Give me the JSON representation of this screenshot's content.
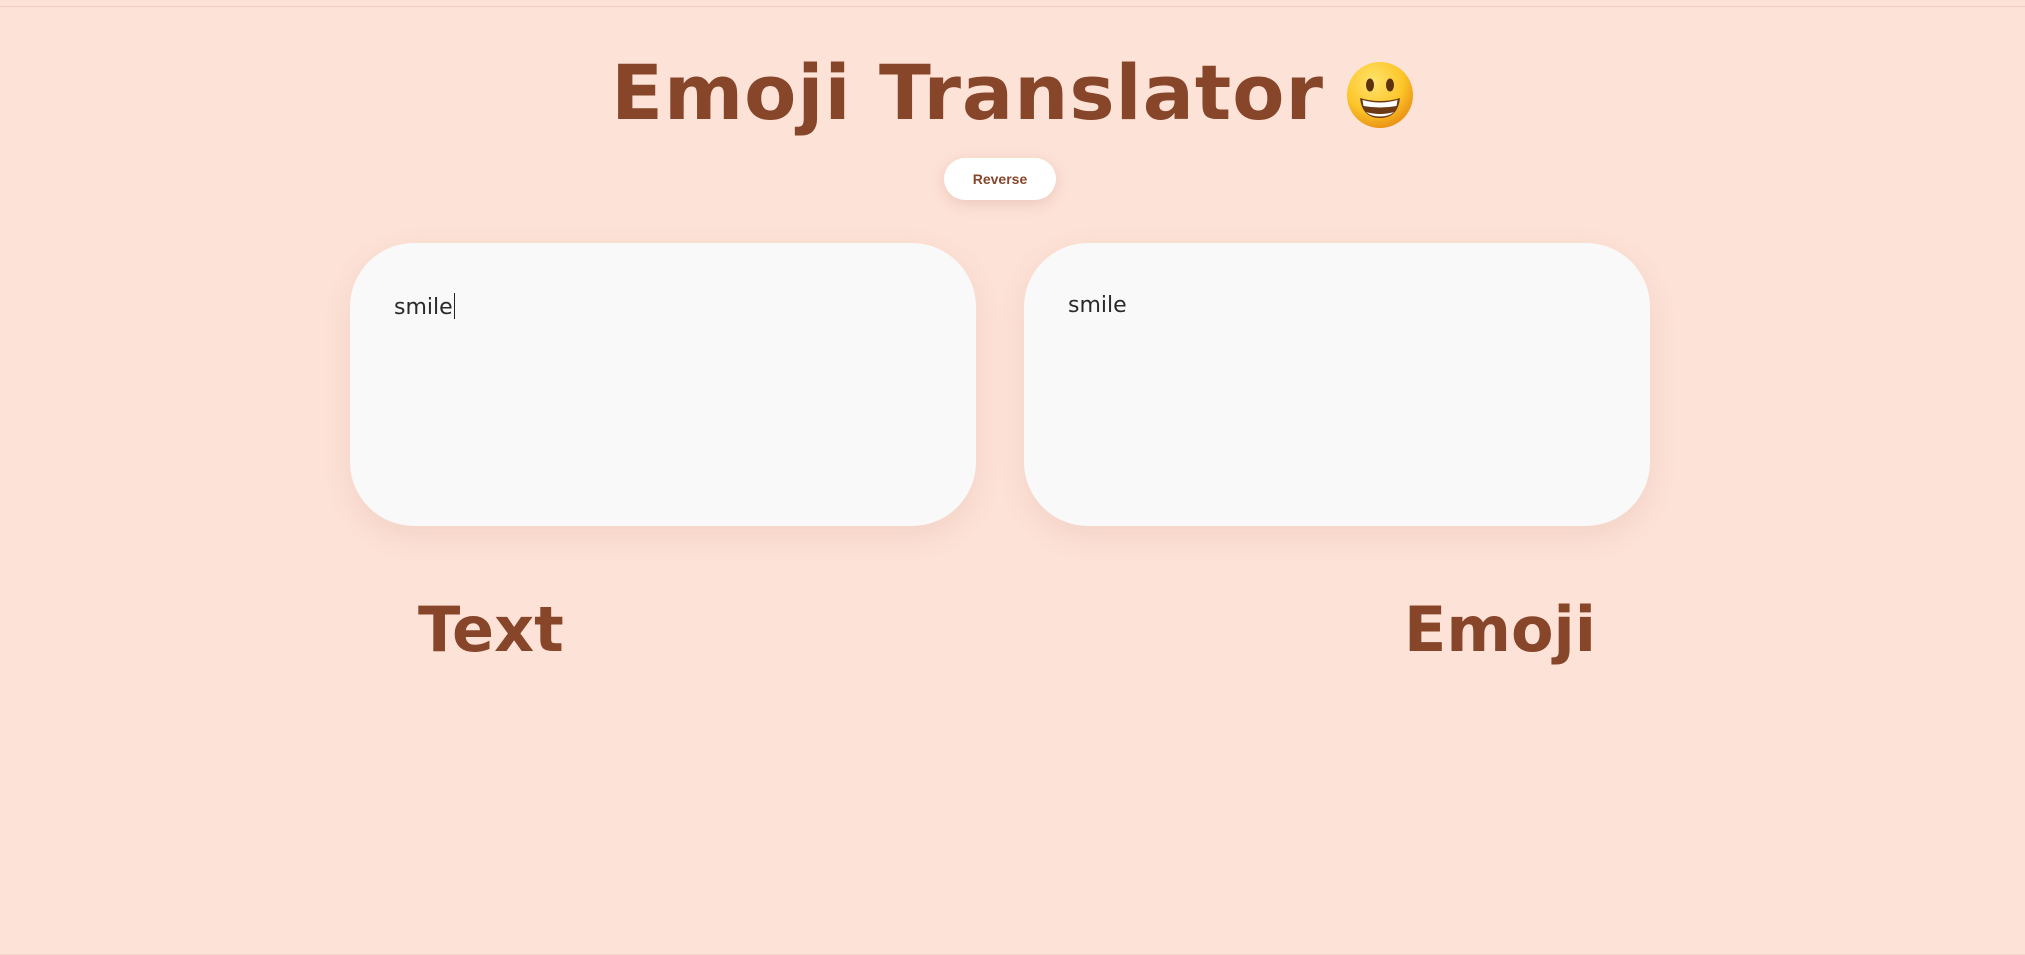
{
  "header": {
    "title": "Emoji Translator",
    "title_emoji_icon": "grinning-face-emoji"
  },
  "controls": {
    "reverse_label": "Reverse"
  },
  "input_panel": {
    "value": "smile",
    "label": "Text"
  },
  "output_panel": {
    "value": "smile",
    "label": "Emoji"
  },
  "colors": {
    "background": "#fde2d7",
    "accent": "#87452a",
    "panel": "#f9f9f9"
  }
}
